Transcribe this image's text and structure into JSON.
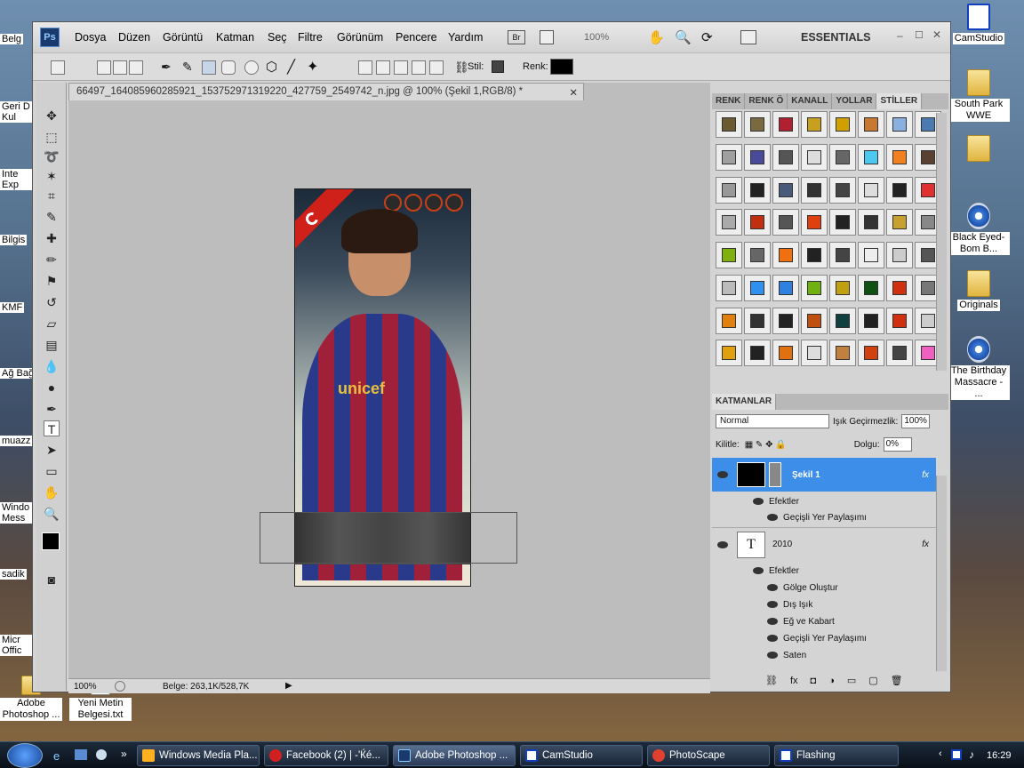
{
  "desktop": {
    "right_icons": [
      {
        "label": "CamStudio",
        "kind": "cam"
      },
      {
        "label": "South Park WWE",
        "kind": "folder"
      },
      {
        "label": "",
        "kind": "folder"
      },
      {
        "label": "Black Eyed-Bom B...",
        "kind": "media"
      },
      {
        "label": "Originals",
        "kind": "folder"
      },
      {
        "label": "The Birthday Massacre - ...",
        "kind": "media"
      }
    ],
    "left_labels": [
      "Belg",
      "Geri D Kul",
      "Inte Exp",
      "Bilgis",
      "KMF",
      "Ağ Bağ",
      "muazz",
      "Windo Mess",
      "sadik",
      "Micr Offic"
    ],
    "bottom_icons": [
      {
        "label": "Adobe Photoshop ..."
      },
      {
        "label": "Yeni Metin Belgesi.txt"
      }
    ]
  },
  "photoshop": {
    "logo": "Ps",
    "menu": [
      "Dosya",
      "Düzen",
      "Görüntü",
      "Katman",
      "Seç",
      "Filtre",
      "Görünüm",
      "Pencere",
      "Yardım"
    ],
    "bridge": "Br",
    "zoom": "100%",
    "workspace": "ESSENTIALS",
    "options": {
      "style_label": "Stil:",
      "color_label": "Renk:",
      "color": "#000000"
    },
    "document_tab": "66497_164085960285921_153752971319220_427759_2549742_n.jpg @ 100% (Şekil 1,RGB/8) *",
    "canvas": {
      "flag_color": "#d0201a",
      "jersey_text": "unicef"
    },
    "status": {
      "zoom": "100%",
      "doc_size": "Belge: 263,1K/528,7K"
    },
    "style_panel_tabs": [
      "RENK",
      "RENK Ö",
      "KANALL",
      "YOLLAR",
      "STİLLER"
    ],
    "layers_panel": {
      "title": "KATMANLAR",
      "blend_mode": "Normal",
      "opacity_label": "Işık Geçirmezlik:",
      "opacity": "100%",
      "lock_label": "Kilitle:",
      "fill_label": "Dolgu:",
      "fill": "0%",
      "layers": [
        {
          "name": "Şekil 1",
          "effects_label": "Efektler",
          "effects": [
            "Geçişli Yer Paylaşımı"
          ]
        },
        {
          "name": "2010",
          "effects_label": "Efektler",
          "effects": [
            "Gölge Oluştur",
            "Dış Işık",
            "Eğ ve Kabart",
            "Geçişli Yer Paylaşımı",
            "Saten"
          ]
        }
      ]
    }
  },
  "taskbar": {
    "tasks": [
      "Windows Media Pla...",
      "Facebook (2) | -'Ќé...",
      "Adobe Photoshop ...",
      "CamStudio",
      "PhotoScape",
      "Flashing"
    ],
    "clock": "16:29"
  }
}
